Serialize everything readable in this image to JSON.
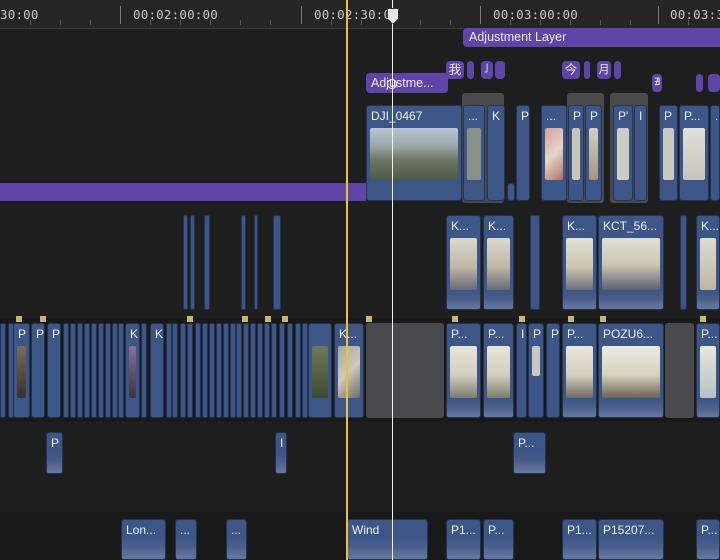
{
  "ruler": {
    "labels": [
      "30:00",
      "00:02:00:00",
      "00:02:30:00",
      "00:03:00:00",
      "00:03:3"
    ]
  },
  "titles": {
    "adjustment_layer": "Adjustment Layer",
    "adjustment_short": "Adjustme...",
    "glyph_1": "我",
    "glyph_2": "亅",
    "glyph_3": "今",
    "glyph_4": "月",
    "glyph_5": "∄"
  },
  "primary_clips": {
    "dji": "DJI_0467",
    "dots_1": "...",
    "k_1": "K",
    "p_1": "P",
    "dots_2": "...",
    "p_2": "P",
    "p_3": "P",
    "p_4": "P'",
    "i_1": "I",
    "p_5": "P",
    "p_6": "P...",
    "dots_3": "..."
  },
  "connected_clips": {
    "k_a": "K...",
    "k_b": "K...",
    "k_c": "K...",
    "kct": "KCT_56...",
    "k_d": "K..."
  },
  "storyline": {
    "p_a": "P",
    "p_b": "P",
    "p_c": "P",
    "k_a": "K",
    "k_b": "K",
    "k_dots": "K...",
    "p_dots_1": "P...",
    "p_dots_2": "P...",
    "i_a": "I",
    "p_d": "P",
    "p_e": "P",
    "p_dots_3": "P...",
    "pozu": "POZU6...",
    "p_dots_4": "P..."
  },
  "lower_clips": {
    "p_small": "P",
    "i_small": "I",
    "p_dots": "P..."
  },
  "audio_clips": {
    "lon": "Lon...",
    "dots_a": "...",
    "dots_b": "...",
    "wind": "Wind",
    "p1_a": "P1...",
    "p_dots_a": "P...",
    "p1_b": "P1...",
    "p15207": "P15207...",
    "p_dots_b": "P..."
  }
}
